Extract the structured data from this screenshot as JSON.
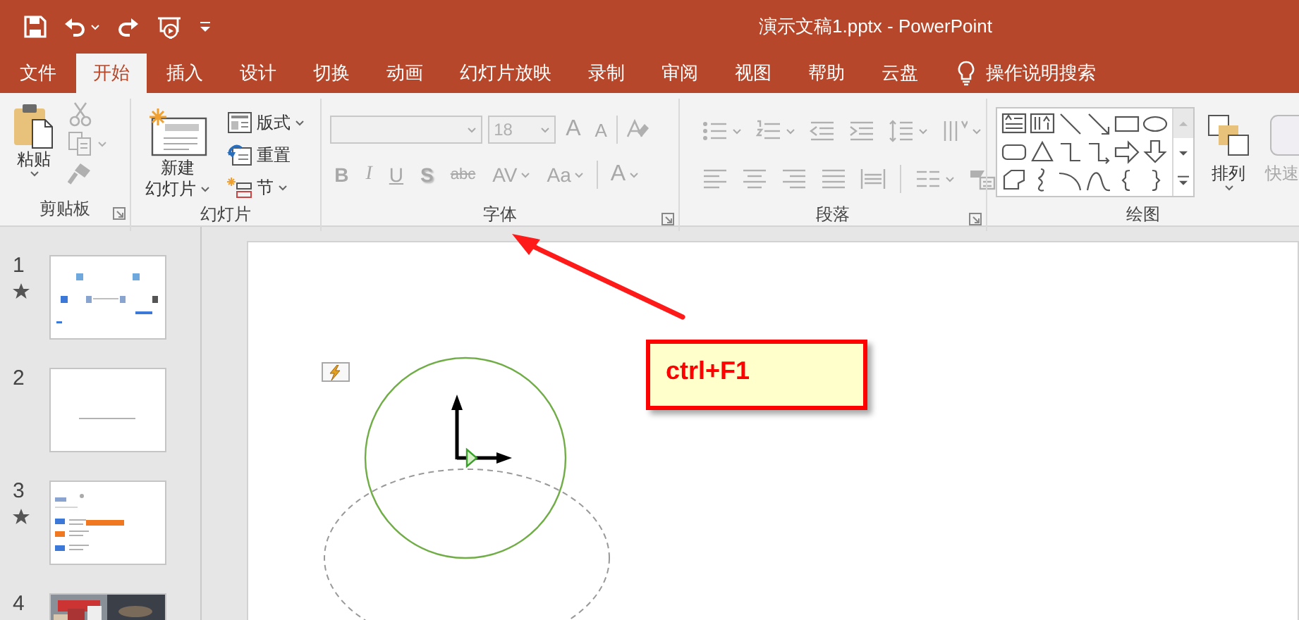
{
  "window": {
    "title": "演示文稿1.pptx  -  PowerPoint"
  },
  "tabs": [
    {
      "label": "文件",
      "selected": false
    },
    {
      "label": "开始",
      "selected": true
    },
    {
      "label": "插入",
      "selected": false
    },
    {
      "label": "设计",
      "selected": false
    },
    {
      "label": "切换",
      "selected": false
    },
    {
      "label": "动画",
      "selected": false
    },
    {
      "label": "幻灯片放映",
      "selected": false
    },
    {
      "label": "录制",
      "selected": false
    },
    {
      "label": "审阅",
      "selected": false
    },
    {
      "label": "视图",
      "selected": false
    },
    {
      "label": "帮助",
      "selected": false
    },
    {
      "label": "云盘",
      "selected": false
    }
  ],
  "tell_me": {
    "label": "操作说明搜索"
  },
  "ribbon": {
    "groups": [
      {
        "kind": "clipboard",
        "title": "剪贴板",
        "launcher": true,
        "paste": "粘贴"
      },
      {
        "kind": "slides",
        "title": "幻灯片",
        "new_slide": [
          "新建",
          "幻灯片"
        ],
        "layout": "版式",
        "reset": "重置",
        "section": "节"
      },
      {
        "kind": "font",
        "title": "字体",
        "launcher": true,
        "disabled": true,
        "font_size": "18",
        "grow": "A",
        "shrink": "A",
        "formats": [
          "B",
          "I",
          "U",
          "S",
          "abc",
          "AV",
          "Aa"
        ],
        "font_color": "A"
      },
      {
        "kind": "paragraph",
        "title": "段落",
        "launcher": true,
        "disabled": true
      },
      {
        "kind": "drawing",
        "title": "绘图",
        "arrange": "排列",
        "quick_styles": {
          "label": "快速",
          "disabled": true
        }
      }
    ]
  },
  "slides": [
    {
      "number": "1",
      "animated": true,
      "kind": "title"
    },
    {
      "number": "2",
      "animated": false,
      "kind": "blank"
    },
    {
      "number": "3",
      "animated": true,
      "kind": "list"
    },
    {
      "number": "4",
      "animated": false
    }
  ],
  "canvas": {
    "callout": "ctrl+F1"
  }
}
